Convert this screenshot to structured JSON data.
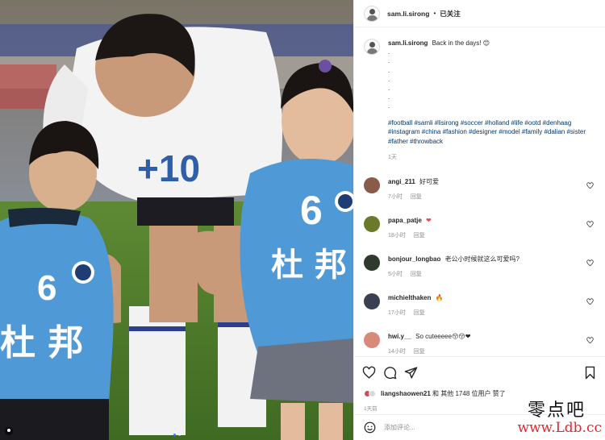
{
  "photo": {
    "jersey_number": "6",
    "jersey_text": "杜 邦",
    "adult_shirt_text": "+10"
  },
  "header": {
    "username": "sam.li.sirong",
    "separator": "•",
    "follow_status": "已关注"
  },
  "caption": {
    "username": "sam.li.sirong",
    "text": "Back in the days! 😊",
    "dots": [
      ".",
      ".",
      ".",
      ".",
      ".",
      ".",
      "."
    ],
    "hashtags": "#football #samli #lisirong #soccer #holland #life #ootd #denhaag #instagram #china #fashion #designer #model #family #dalian #sister #father #throwback",
    "time": "1天"
  },
  "comments": [
    {
      "username": "angi_211",
      "text": "好可爱",
      "time": "7小时",
      "reply": "回复",
      "avatar_color": "#8a5a4a"
    },
    {
      "username": "papa_patje",
      "text": "❤",
      "time": "18小时",
      "reply": "回复",
      "avatar_color": "#6b7a2a"
    },
    {
      "username": "bonjour_longbao",
      "text": "老公小时候就这么可爱吗?",
      "time": "5小时",
      "reply": "回复",
      "avatar_color": "#2f3a2f"
    },
    {
      "username": "michielthaken",
      "text": "🔥",
      "time": "17小时",
      "reply": "回复",
      "avatar_color": "#3a3f52"
    },
    {
      "username": "hwi.y__",
      "text": "So cuteeeee😚😚❤",
      "time": "14小时",
      "reply": "回复",
      "avatar_color": "#d88a7a"
    }
  ],
  "likes": {
    "username": "liangshaowen21",
    "text": "和 其他 1748 位用户 赞了"
  },
  "post_time": "1天前",
  "add_comment": {
    "placeholder": "添加评论..."
  },
  "watermark": {
    "top": "零点吧",
    "bottom": "www.Ldb.cc"
  },
  "colors": {
    "hashtag": "#00376b",
    "muted": "#8e8e8e",
    "like_red": "#ed4956",
    "jersey_blue": "#4f9ad6"
  }
}
